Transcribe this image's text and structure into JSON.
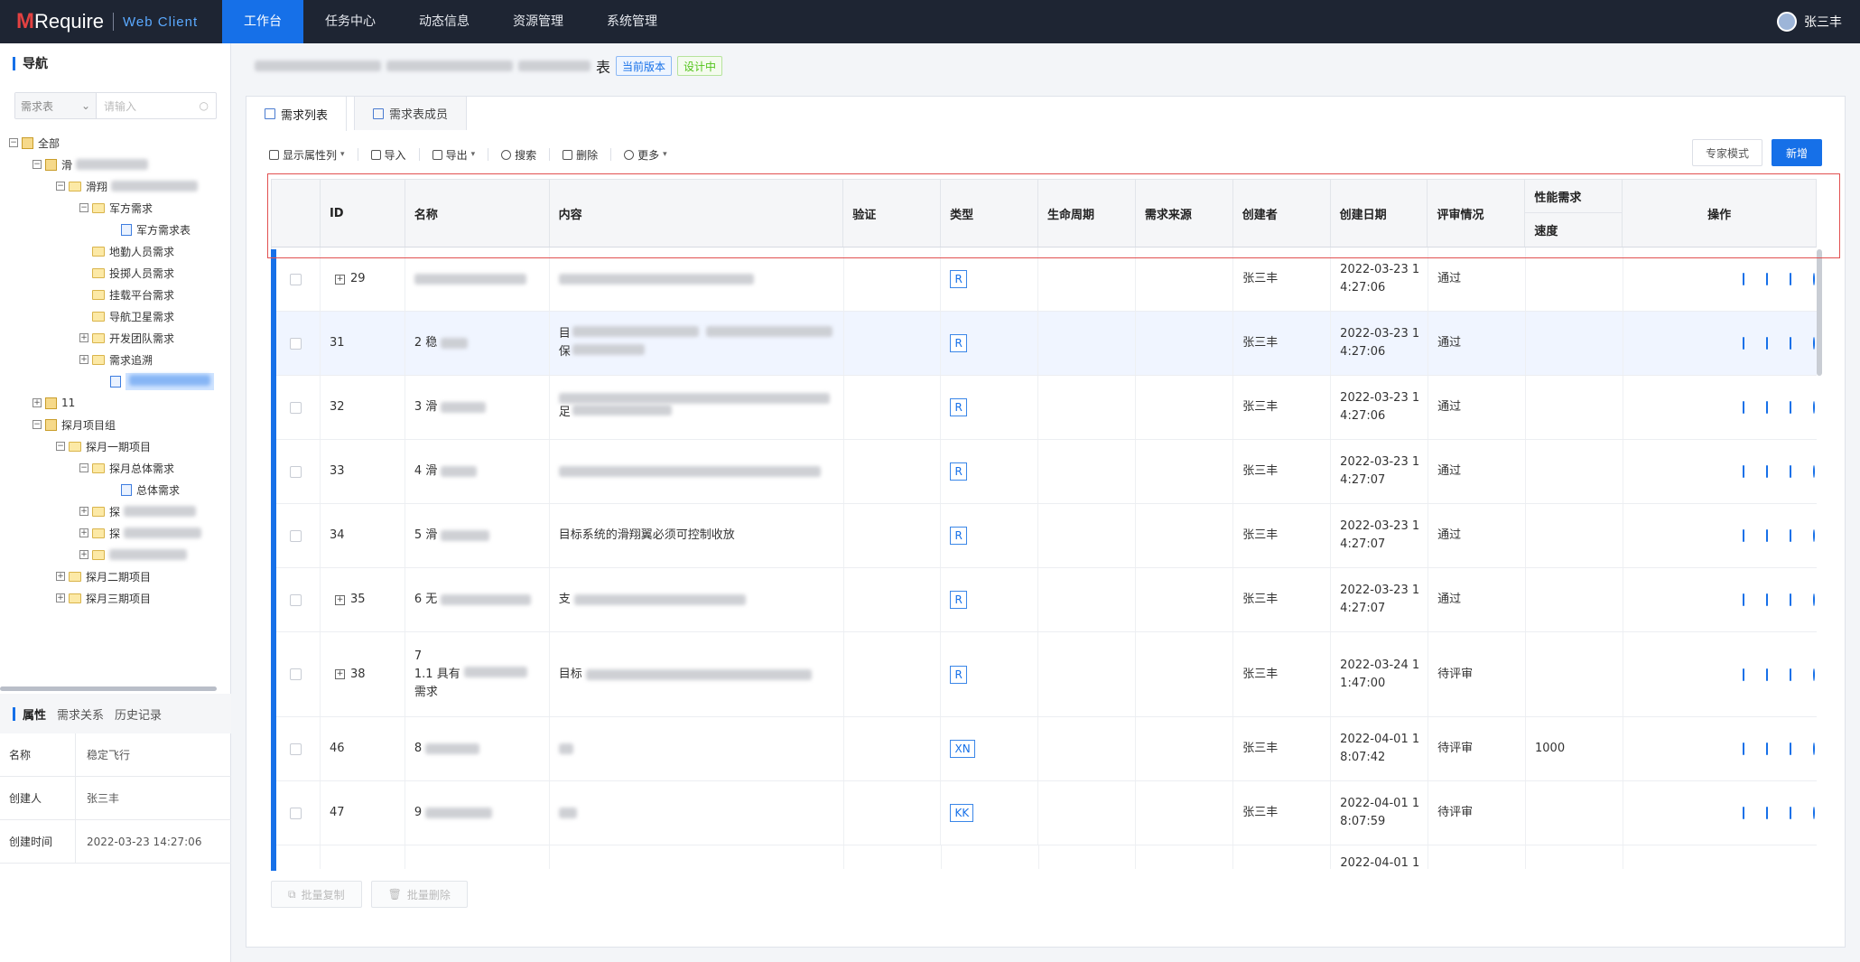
{
  "app": {
    "logo_m": "M",
    "logo_text": "Require",
    "logo_sub": "Web Client"
  },
  "nav": [
    "工作台",
    "任务中心",
    "动态信息",
    "资源管理",
    "系统管理"
  ],
  "user": {
    "name": "张三丰"
  },
  "left": {
    "title": "导航",
    "filter_select": "需求表",
    "filter_placeholder": "请输入",
    "tree": [
      {
        "label": "全部",
        "level": 0
      },
      {
        "label": "滑",
        "level": 1
      },
      {
        "label": "滑翔",
        "level": 2
      },
      {
        "label": "军方需求",
        "level": 3
      },
      {
        "label": "军方需求表",
        "level": 4
      },
      {
        "label": "地勤人员需求",
        "level": 3
      },
      {
        "label": "投掷人员需求",
        "level": 3
      },
      {
        "label": "挂载平台需求",
        "level": 3
      },
      {
        "label": "导航卫星需求",
        "level": 3
      },
      {
        "label": "开发团队需求",
        "level": 3
      },
      {
        "label": "需求追溯",
        "level": 3
      },
      {
        "label": "",
        "level": 3
      },
      {
        "label": "11",
        "level": 1
      },
      {
        "label": "探月项目组",
        "level": 1
      },
      {
        "label": "探月一期项目",
        "level": 2
      },
      {
        "label": "探月总体需求",
        "level": 3
      },
      {
        "label": "总体需求",
        "level": 4
      },
      {
        "label": "探",
        "level": 3
      },
      {
        "label": "探",
        "level": 3
      },
      {
        "label": "",
        "level": 3
      },
      {
        "label": "探月二期项目",
        "level": 2
      },
      {
        "label": "探月三期项目",
        "level": 2
      }
    ],
    "props_tabs": [
      "属性",
      "需求关系",
      "历史记录"
    ],
    "props": [
      {
        "k": "名称",
        "v": "稳定飞行"
      },
      {
        "k": "创建人",
        "v": "张三丰"
      },
      {
        "k": "创建时间",
        "v": "2022-03-23 14:27:06"
      }
    ]
  },
  "header": {
    "title_tail": "表",
    "badge_version": "当前版本",
    "badge_status": "设计中"
  },
  "tabs": [
    "需求列表",
    "需求表成员"
  ],
  "toolbar": [
    "显示属性列",
    "导入",
    "导出",
    "搜索",
    "删除",
    "更多"
  ],
  "btn_expert": "专家模式",
  "btn_new": "新增",
  "columns": [
    "ID",
    "名称",
    "内容",
    "验证",
    "类型",
    "生命周期",
    "需求来源",
    "创建者",
    "创建日期",
    "评审情况",
    "性能需求",
    "速度",
    "操作"
  ],
  "rows": [
    {
      "id": "29",
      "expand": true,
      "name": "",
      "content": "",
      "type": "R",
      "creator": "张三丰",
      "date1": "2022-03-23 1",
      "date2": "4:27:06",
      "review": "通过",
      "speed": ""
    },
    {
      "id": "31",
      "expand": false,
      "name": "2 稳",
      "content": "目",
      "content2": "保",
      "type": "R",
      "creator": "张三丰",
      "date1": "2022-03-23 1",
      "date2": "4:27:06",
      "review": "通过",
      "speed": ""
    },
    {
      "id": "32",
      "expand": false,
      "name": "3 滑",
      "content": "",
      "content2": "足",
      "type": "R",
      "creator": "张三丰",
      "date1": "2022-03-23 1",
      "date2": "4:27:06",
      "review": "通过",
      "speed": ""
    },
    {
      "id": "33",
      "expand": false,
      "name": "4 滑",
      "content": "",
      "type": "R",
      "creator": "张三丰",
      "date1": "2022-03-23 1",
      "date2": "4:27:07",
      "review": "通过",
      "speed": ""
    },
    {
      "id": "34",
      "expand": false,
      "name": "5 滑",
      "content": "目标系统的滑翔翼必须可控制收放",
      "type": "R",
      "creator": "张三丰",
      "date1": "2022-03-23 1",
      "date2": "4:27:07",
      "review": "通过",
      "speed": ""
    },
    {
      "id": "35",
      "expand": true,
      "name": "6 无",
      "content": "支",
      "type": "R",
      "creator": "张三丰",
      "date1": "2022-03-23 1",
      "date2": "4:27:07",
      "review": "通过",
      "speed": ""
    },
    {
      "id": "38",
      "expand": true,
      "name": "7",
      "name2": "1.1 具有",
      "name3": "需求",
      "content": "目标",
      "type": "R",
      "creator": "张三丰",
      "date1": "2022-03-24 1",
      "date2": "1:47:00",
      "review": "待评审",
      "speed": ""
    },
    {
      "id": "46",
      "expand": false,
      "name": "8",
      "content": "",
      "type": "XN",
      "creator": "张三丰",
      "date1": "2022-04-01 1",
      "date2": "8:07:42",
      "review": "待评审",
      "speed": "1000"
    },
    {
      "id": "47",
      "expand": false,
      "name": "9",
      "content": "",
      "type": "KK",
      "creator": "张三丰",
      "date1": "2022-04-01 1",
      "date2": "8:07:59",
      "review": "待评审",
      "speed": ""
    },
    {
      "id": "",
      "expand": false,
      "name": "",
      "content": "",
      "type": "",
      "creator": "",
      "date1": "2022-04-01 1",
      "date2": "",
      "review": "",
      "speed": ""
    }
  ],
  "bottom": {
    "copy": "批量复制",
    "delete": "批量删除"
  }
}
